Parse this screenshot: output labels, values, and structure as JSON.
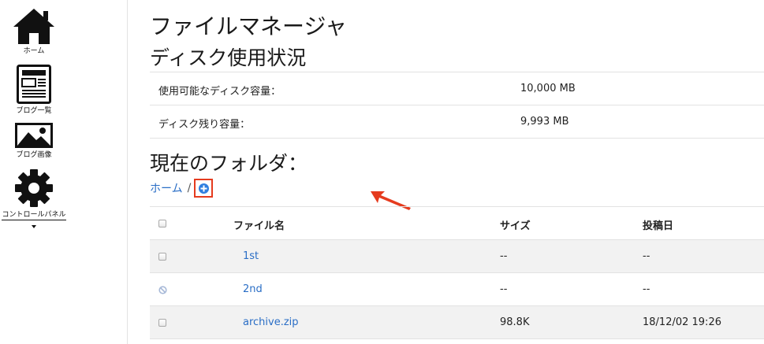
{
  "sidebar": {
    "items": [
      {
        "label": "ホーム",
        "icon": "home-icon"
      },
      {
        "label": "ブログ一覧",
        "icon": "blog-list-icon"
      },
      {
        "label": "ブログ画像",
        "icon": "image-icon"
      },
      {
        "label": "コントロールパネル",
        "icon": "gear-icon"
      }
    ]
  },
  "page": {
    "title": "ファイルマネージャ",
    "disk_section_title": "ディスク使用状況",
    "folder_title": "現在のフォルダ："
  },
  "disk": [
    {
      "label": "使用可能なディスク容量：",
      "value": "10,000 MB"
    },
    {
      "label": "ディスク残り容量：",
      "value": "9,993 MB"
    }
  ],
  "breadcrumb": {
    "home": "ホーム",
    "separator": "/"
  },
  "table": {
    "headers": {
      "name": "ファイル名",
      "size": "サイズ",
      "date": "投稿日"
    },
    "rows": [
      {
        "name": "1st",
        "size": "--",
        "date": "--",
        "selectable": true
      },
      {
        "name": "2nd",
        "size": "--",
        "date": "--",
        "selectable": false
      },
      {
        "name": "archive.zip",
        "size": "98.8K",
        "date": "18/12/02 19:26",
        "selectable": true
      }
    ]
  },
  "colors": {
    "link": "#2a6ec6",
    "add_button": "#2f7fe0",
    "highlight": "#e53b1e"
  }
}
